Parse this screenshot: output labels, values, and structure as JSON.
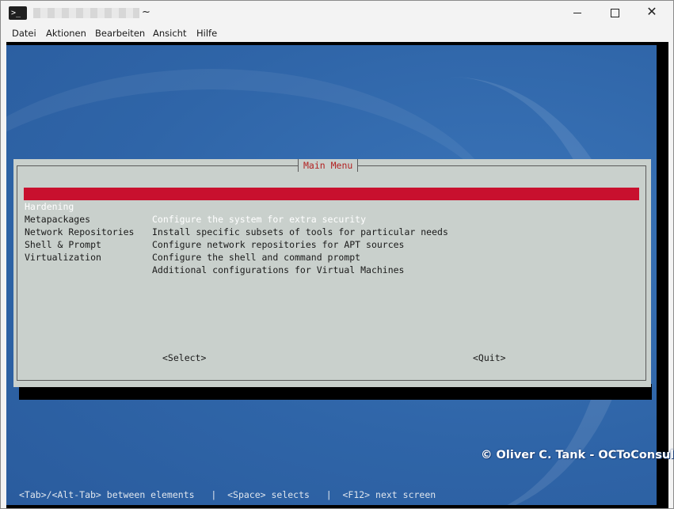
{
  "window": {
    "title_suffix": "~",
    "app_icon_glyph": ">_",
    "controls": {
      "minimize": "—",
      "maximize": "☐",
      "close": "✕"
    }
  },
  "menubar": [
    "Datei",
    "Aktionen",
    "Bearbeiten",
    "Ansicht",
    "Hilfe"
  ],
  "dialog": {
    "title": "Main Menu",
    "items": [
      {
        "tag": "Hardening",
        "desc": "Configure the system for extra security",
        "selected": true
      },
      {
        "tag": "Metapackages",
        "desc": "Install specific subsets of tools for particular needs",
        "selected": false
      },
      {
        "tag": "Network Repositories",
        "desc": "Configure network repositories for APT sources",
        "selected": false
      },
      {
        "tag": "Shell & Prompt",
        "desc": "Configure the shell and command prompt",
        "selected": false
      },
      {
        "tag": "Virtualization",
        "desc": "Additional configurations for Virtual Machines",
        "selected": false
      }
    ],
    "buttons": {
      "select": "<Select>",
      "quit": "<Quit>"
    }
  },
  "statusline": "<Tab>/<Alt-Tab> between elements   |  <Space> selects   |  <F12> next screen",
  "watermark": "© Oliver C. Tank - OCToConsult",
  "colors": {
    "desktop_blue": "#2f65a8",
    "dialog_bg": "#c9d0cc",
    "selection_red": "#c8102e",
    "title_red": "#b22222"
  }
}
